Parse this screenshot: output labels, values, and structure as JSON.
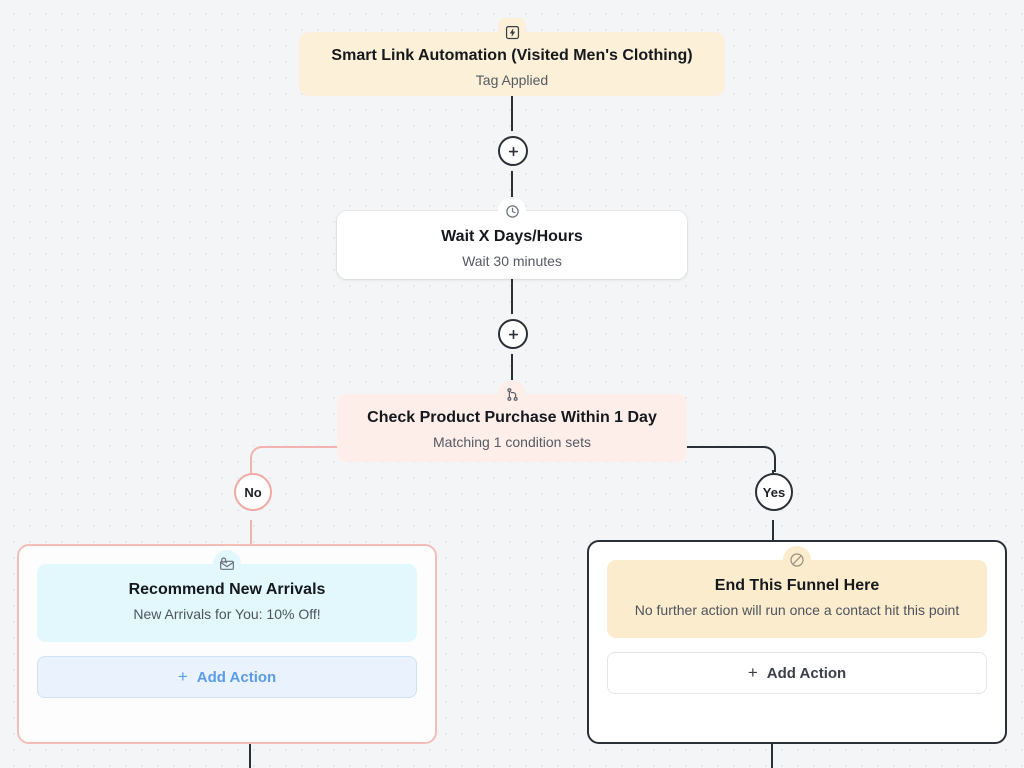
{
  "canvas": {
    "background_color": "#f4f5f7",
    "dot_color": "#e2e4e9"
  },
  "colors": {
    "trigger_fill": "#fcf0d8",
    "condition_fill": "#fdeeea",
    "email_fill": "#e2f8fc",
    "end_fill": "#fbeccd",
    "yes_line": "#2b2f36",
    "no_line": "#f2b3ae",
    "add_action_blue": "#5b9be8"
  },
  "nodes": {
    "trigger": {
      "icon": "lightning-bolt-icon",
      "title": "Smart Link Automation (Visited Men's Clothing)",
      "subtitle": "Tag Applied"
    },
    "wait": {
      "icon": "clock-icon",
      "title": "Wait X Days/Hours",
      "subtitle": "Wait 30 minutes"
    },
    "condition": {
      "icon": "git-branch-icon",
      "title": "Check Product Purchase Within 1 Day",
      "subtitle": "Matching 1 condition sets"
    }
  },
  "branches": {
    "no": {
      "label": "No",
      "action": {
        "icon": "envelope-open-icon",
        "title": "Recommend New Arrivals",
        "subtitle": "New Arrivals for You: 10% Off!"
      },
      "add_action_label": "Add Action",
      "add_action_plus": "+"
    },
    "yes": {
      "label": "Yes",
      "action": {
        "icon": "no-entry-slash-icon",
        "title": "End This Funnel Here",
        "subtitle": "No further action will run once a contact hit this point"
      },
      "add_action_label": "Add Action",
      "add_action_plus": "+"
    }
  },
  "connectors": {
    "add_step_top": "add-step-button",
    "add_step_middle": "add-step-button"
  }
}
